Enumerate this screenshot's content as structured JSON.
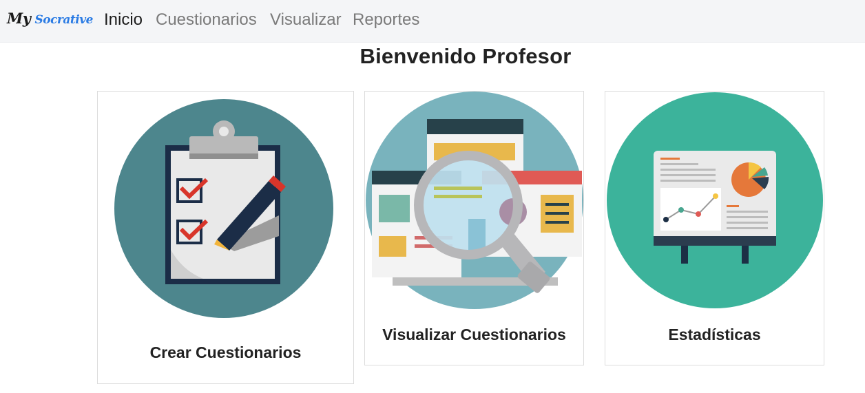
{
  "nav": {
    "brand_my": "My",
    "brand_socrative": "Socrative",
    "items": [
      {
        "label": "Inicio",
        "active": true
      },
      {
        "label": "Cuestionarios",
        "active": false
      },
      {
        "label": "Visualizar",
        "active": false
      },
      {
        "label": "Reportes",
        "active": false
      }
    ]
  },
  "main": {
    "welcome": "Bienvenido Profesor",
    "cards": [
      {
        "title": "Crear Cuestionarios",
        "icon": "clipboard-checklist-icon"
      },
      {
        "title": "Visualizar Cuestionarios",
        "icon": "magnifier-webpage-icon"
      },
      {
        "title": "Estadísticas",
        "icon": "presentation-board-icon"
      }
    ]
  },
  "colors": {
    "navbar_bg": "#f4f5f7",
    "brand_accent": "#2a7be4",
    "card1_circle": "#4d868d",
    "card2_circle": "#79b3bd",
    "card3_circle": "#3cb39b"
  }
}
